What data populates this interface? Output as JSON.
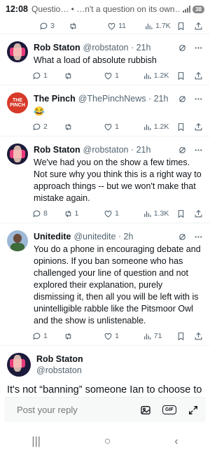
{
  "status": {
    "time": "12:08",
    "overlay": "Questio… • …n't a question on its own…",
    "battery": "38"
  },
  "first_actions": {
    "replies": "3",
    "retweets": "",
    "likes": "11",
    "views": "1.7K"
  },
  "tweets": [
    {
      "name": "Rob Staton",
      "handle": "@robstaton · 21h",
      "text": "What a load of absolute rubbish",
      "replies": "1",
      "retweets": "",
      "likes": "1",
      "views": "1.2K"
    },
    {
      "name": "The Pinch",
      "handle": "@ThePinchNews · 21h",
      "text": "😂",
      "avatar_text": "THE PINCH",
      "replies": "2",
      "retweets": "",
      "likes": "1",
      "views": "1.2K"
    },
    {
      "name": "Rob Staton",
      "handle": "@robstaton · 21h",
      "text": "We've had you on the show a few times. Not sure why you think this is a right way to approach things -- but we won't make that mistake again.",
      "replies": "8",
      "retweets": "1",
      "likes": "1",
      "views": "1.3K"
    },
    {
      "name": "Unitedite",
      "handle": "@unitedite · 2h",
      "text": "You do a phone in encouraging debate and opinions. If you ban someone who has challenged your line of question and not explored their explanation, purely dismissing it, then all you will be left with is unintelligible rabble like the Pitsmoor Owl and the show is unlistenable.",
      "replies": "1",
      "retweets": "",
      "likes": "1",
      "views": "71"
    }
  ],
  "main_tweet": {
    "name": "Rob Staton",
    "handle": "@robstaton",
    "text": "It's not “banning” someone Ian to choose to no longer book someone as a guest, as we"
  },
  "reply": {
    "placeholder": "Post your reply",
    "gif_label": "GIF"
  },
  "nav": {
    "recents": "|||",
    "home": "○",
    "back": "‹"
  },
  "icons": [
    "reply-icon",
    "retweet-icon",
    "like-icon",
    "views-icon",
    "bookmark-icon",
    "share-icon",
    "grok-icon",
    "more-icon",
    "image-icon",
    "expand-icon"
  ],
  "colors": {
    "secondary_text": "#536471",
    "divider": "#eff3f4"
  }
}
